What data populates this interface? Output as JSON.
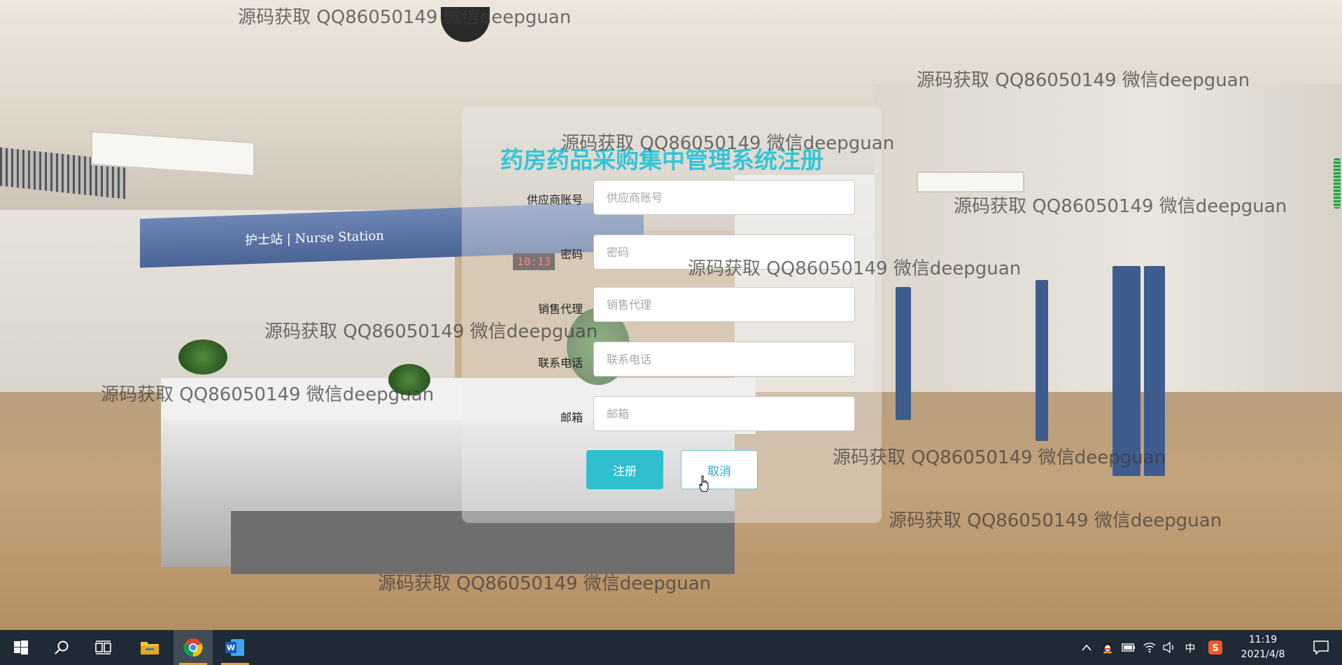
{
  "form": {
    "title": "药房药品采购集中管理系统注册",
    "fields": [
      {
        "label": "供应商账号",
        "placeholder": "供应商账号",
        "value": ""
      },
      {
        "label": "密码",
        "placeholder": "密码",
        "value": ""
      },
      {
        "label": "销售代理",
        "placeholder": "销售代理",
        "value": ""
      },
      {
        "label": "联系电话",
        "placeholder": "联系电话",
        "value": ""
      },
      {
        "label": "邮箱",
        "placeholder": "邮箱",
        "value": ""
      }
    ],
    "buttons": {
      "register": "注册",
      "cancel": "取消"
    },
    "accent_color": "#2fbfcf"
  },
  "background": {
    "sign_text": "护士站 | Nurse Station",
    "clock_display": "10:13"
  },
  "watermark": "源码获取 QQ86050149 微信deepguan",
  "taskbar": {
    "apps": [
      "start-icon",
      "search-icon",
      "task-view-icon",
      "file-explorer-icon",
      "chrome-icon",
      "word-icon"
    ],
    "tray": {
      "ime_label": "中",
      "time": "11:19",
      "date": "2021/4/8"
    }
  }
}
